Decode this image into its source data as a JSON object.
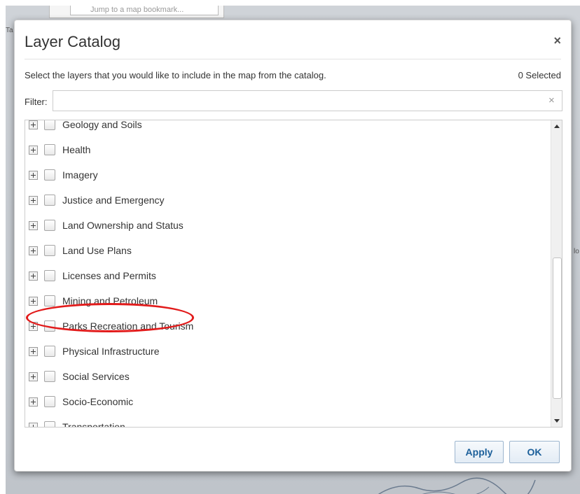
{
  "background": {
    "bookmark_placeholder": "Jump to a map bookmark...",
    "edge_left_text": "Ta",
    "edge_right_text": "lo"
  },
  "dialog": {
    "title": "Layer Catalog",
    "close_glyph": "×",
    "instructions": "Select the layers that you would like to include in the map from the catalog.",
    "selected_count": "0 Selected",
    "filter_label": "Filter:",
    "filter_value": "",
    "filter_clear_glyph": "×",
    "layers": [
      {
        "label": "Geology and Soils",
        "checked": false
      },
      {
        "label": "Health",
        "checked": false
      },
      {
        "label": "Imagery",
        "checked": false
      },
      {
        "label": "Justice and Emergency",
        "checked": false
      },
      {
        "label": "Land Ownership and Status",
        "checked": false
      },
      {
        "label": "Land Use Plans",
        "checked": false
      },
      {
        "label": "Licenses and Permits",
        "checked": false
      },
      {
        "label": "Mining and Petroleum",
        "checked": false,
        "highlighted": true
      },
      {
        "label": "Parks Recreation and Tourism",
        "checked": false
      },
      {
        "label": "Physical Infrastructure",
        "checked": false
      },
      {
        "label": "Social Services",
        "checked": false
      },
      {
        "label": "Socio-Economic",
        "checked": false
      },
      {
        "label": "Transportation",
        "checked": false
      }
    ],
    "apply_label": "Apply",
    "ok_label": "OK"
  },
  "colors": {
    "highlight_ring": "#e21b1b",
    "button_text": "#1b5f9a"
  }
}
